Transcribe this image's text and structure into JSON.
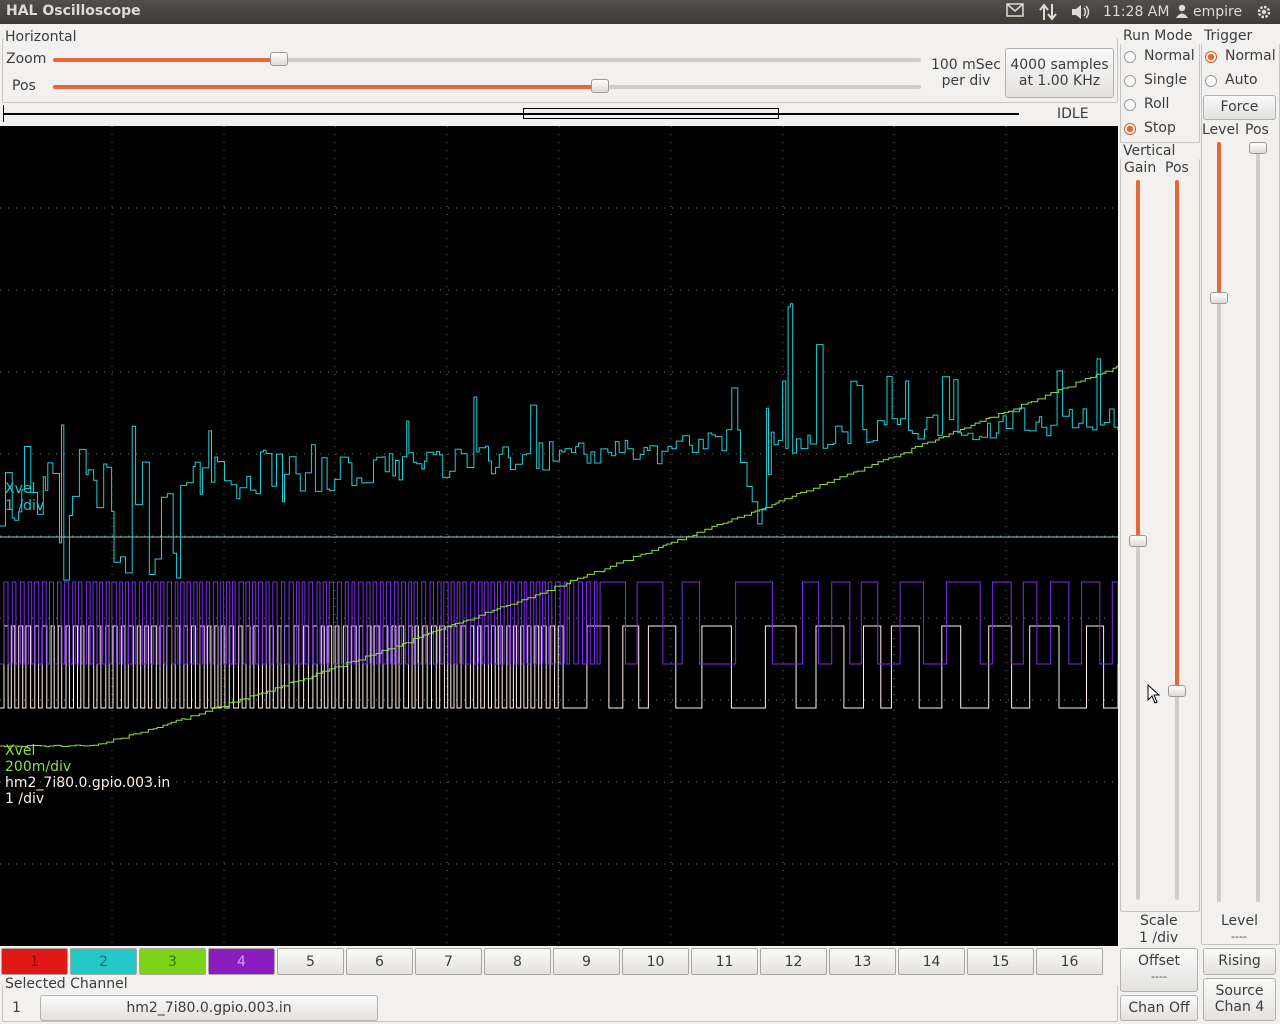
{
  "window": {
    "title": "HAL Oscilloscope"
  },
  "topbar": {
    "time": "11:28 AM",
    "user": "empire"
  },
  "horizontal": {
    "section_label": "Horizontal",
    "zoom_label": "Zoom",
    "pos_label": "Pos",
    "zoom_value": 0.26,
    "pos_value": 0.63,
    "timebase_line1": "100 mSec",
    "timebase_line2": "per div",
    "samples_line1": "4000 samples",
    "samples_line2": "at 1.00 KHz",
    "state": "IDLE"
  },
  "run_mode": {
    "label": "Run Mode",
    "options": [
      "Normal",
      "Single",
      "Roll",
      "Stop"
    ],
    "selected": "Stop"
  },
  "trigger": {
    "label": "Trigger",
    "options": [
      "Normal",
      "Auto"
    ],
    "selected": "Normal",
    "force_label": "Force",
    "level_label": "Level",
    "pos_label": "Pos",
    "level_readout_label": "Level",
    "level_readout_value": "----",
    "edge_button": "Rising",
    "source_line1": "Source",
    "source_line2": "Chan 4"
  },
  "vertical": {
    "label": "Vertical",
    "gain_label": "Gain",
    "pos_label": "Pos",
    "scale_label": "Scale",
    "scale_value": "1 /div",
    "offset_label": "Offset",
    "offset_value": "----",
    "chan_off_label": "Chan Off"
  },
  "trace_labels": {
    "ch2_name": "Xvel",
    "ch2_scale": "1 /div",
    "ch3_name": "Xvel",
    "ch3_scale": "200m/div",
    "ch1_name": "hm2_7i80.0.gpio.003.in",
    "ch1_scale": "1 /div"
  },
  "channels": [
    {
      "label": "1",
      "color": "#e01818"
    },
    {
      "label": "2",
      "color": "#22c8c8"
    },
    {
      "label": "3",
      "color": "#7cd318"
    },
    {
      "label": "4",
      "color": "#8a1cc0"
    },
    {
      "label": "5"
    },
    {
      "label": "6"
    },
    {
      "label": "7"
    },
    {
      "label": "8"
    },
    {
      "label": "9"
    },
    {
      "label": "10"
    },
    {
      "label": "11"
    },
    {
      "label": "12"
    },
    {
      "label": "13"
    },
    {
      "label": "14"
    },
    {
      "label": "15"
    },
    {
      "label": "16"
    }
  ],
  "selected_channel": {
    "label": "Selected Channel",
    "number": "1",
    "name": "hm2_7i80.0.gpio.003.in"
  },
  "colors": {
    "ch1_trace": "#fff0e8",
    "ch2_trace": "#1fd0d8",
    "ch3_trace": "#8ee040",
    "ch4_trace": "#7a2ee8",
    "accent": "#e4683a"
  }
}
